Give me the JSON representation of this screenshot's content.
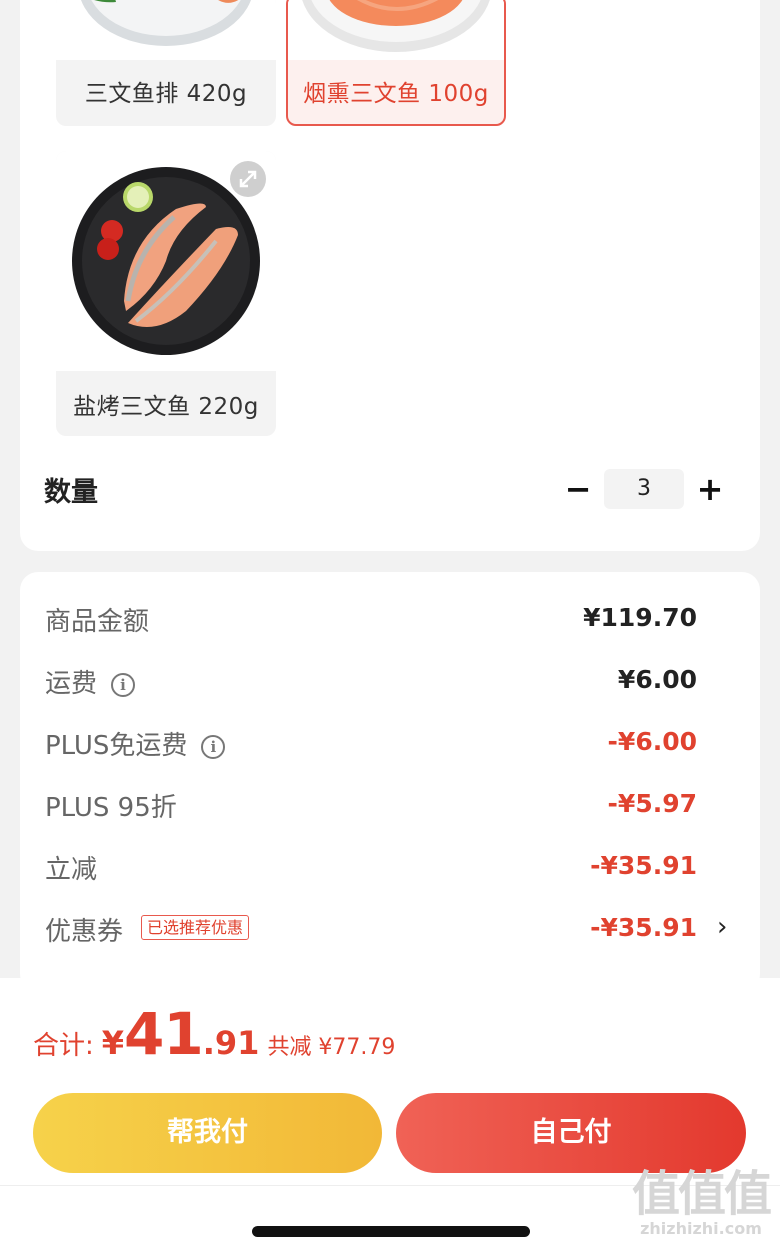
{
  "variants": [
    {
      "label": "三文鱼排 420g",
      "selected": false
    },
    {
      "label": "烟熏三文鱼 100g",
      "selected": true
    },
    {
      "label": "盐烤三文鱼 220g",
      "selected": false
    }
  ],
  "quantity": {
    "label": "数量",
    "minus": "−",
    "value": "3",
    "plus": "+"
  },
  "price_rows": [
    {
      "label": "商品金额",
      "value": "¥119.70",
      "red": false
    },
    {
      "label": "运费",
      "value": "¥6.00",
      "red": false,
      "info": "i"
    },
    {
      "label": "PLUS免运费",
      "value": "-¥6.00",
      "red": true,
      "info": "i"
    },
    {
      "label": "PLUS 95折",
      "value": "-¥5.97",
      "red": true
    },
    {
      "label": "立减",
      "value": "-¥35.91",
      "red": true
    },
    {
      "label": "优惠券",
      "value": "-¥35.91",
      "red": true,
      "tag": "已选推荐优惠",
      "chevron": "›"
    }
  ],
  "summary": {
    "label": "合计:",
    "yen": "¥",
    "integer": "41",
    "decimal": ".91",
    "saved": "共减 ¥77.79"
  },
  "buttons": {
    "help_pay": "帮我付",
    "self_pay": "自己付"
  },
  "watermark": {
    "big": "值值值",
    "small": "zhizhizhi.com"
  },
  "colors": {
    "accent_red": "#e0422f",
    "yellow_button": "#f2c23f",
    "red_button": "#e8473a"
  }
}
